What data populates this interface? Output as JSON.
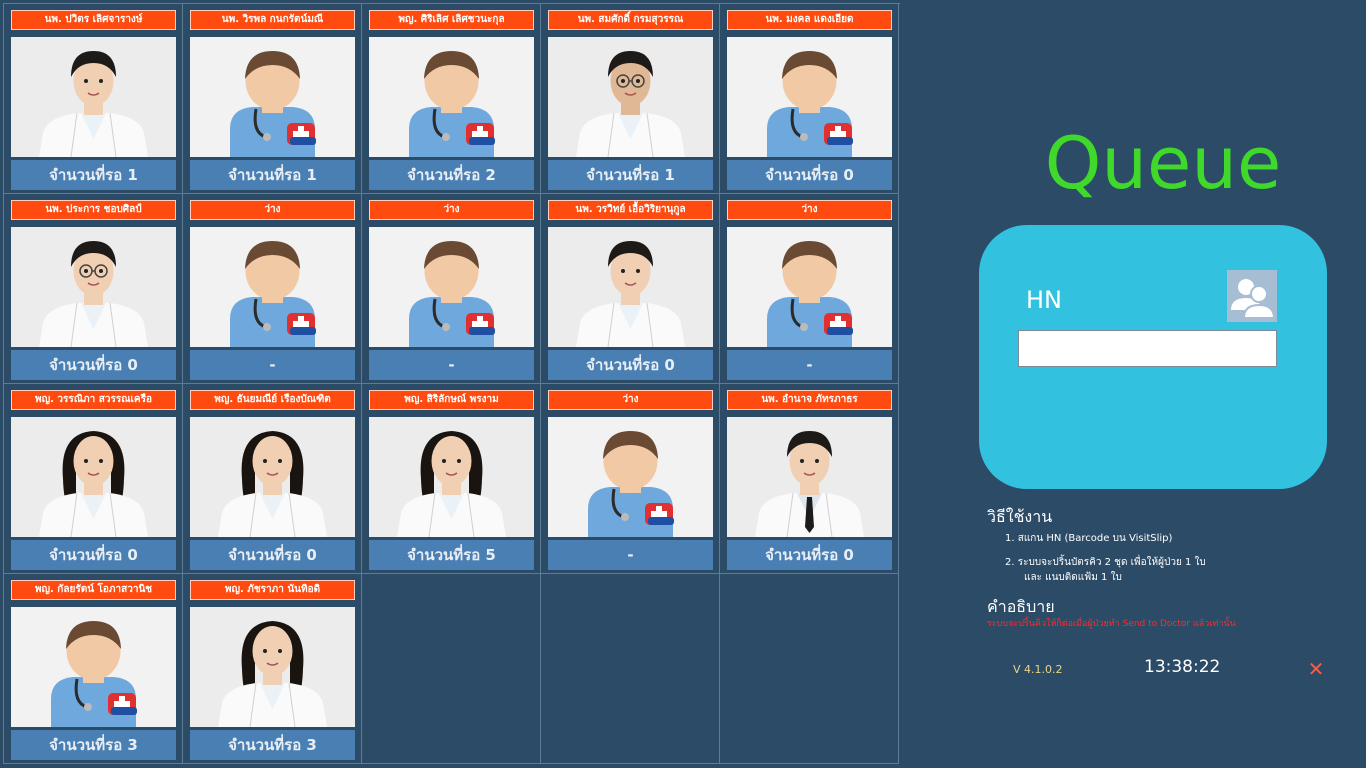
{
  "doctors": [
    {
      "name": "นพ. ปวิตร เลิศจารางษ์",
      "count": "จำนวนที่รอ  1",
      "photo": "photo-man-young"
    },
    {
      "name": "นพ. วิรพล กนกรัตน์มณี",
      "count": "จำนวนที่รอ  1",
      "photo": "placeholder"
    },
    {
      "name": "พญ. ศิริเลิศ เลิศชวนะกุล",
      "count": "จำนวนที่รอ  2",
      "photo": "placeholder"
    },
    {
      "name": "นพ. สมศักดิ์ กรมสุวรรณ",
      "count": "จำนวนที่รอ  1",
      "photo": "photo-man-glasses"
    },
    {
      "name": "นพ. มงคล แดงเอียด",
      "count": "จำนวนที่รอ  0",
      "photo": "placeholder"
    },
    {
      "name": "นพ. ประการ ชอบศิลป์",
      "count": "จำนวนที่รอ  0",
      "photo": "photo-man-glasses-2"
    },
    {
      "name": "ว่าง",
      "count": "-",
      "photo": "placeholder"
    },
    {
      "name": "ว่าง",
      "count": "-",
      "photo": "placeholder"
    },
    {
      "name": "นพ. วรวิทย์ เอื้อวิริยานุกูล",
      "count": "จำนวนที่รอ  0",
      "photo": "photo-man-young-2"
    },
    {
      "name": "ว่าง",
      "count": "-",
      "photo": "placeholder"
    },
    {
      "name": "พญ. วรรณิภา สวรรณเครือ",
      "count": "จำนวนที่รอ  0",
      "photo": "photo-woman-1"
    },
    {
      "name": "พญ. ธันยมณีย์ เรืองบัณฑิต",
      "count": "จำนวนที่รอ  0",
      "photo": "photo-woman-2"
    },
    {
      "name": "พญ. สิริลักษณ์ พรงาม",
      "count": "จำนวนที่รอ  5",
      "photo": "photo-woman-3"
    },
    {
      "name": "ว่าง",
      "count": "-",
      "photo": "placeholder"
    },
    {
      "name": "นพ. อำนาจ ภัทรภาธร",
      "count": "จำนวนที่รอ  0",
      "photo": "photo-man-young-3"
    },
    {
      "name": "พญ. กัลยรัตน์ โอภาสวานิช",
      "count": "จำนวนที่รอ  3",
      "photo": "placeholder"
    },
    {
      "name": "พญ. ภัชราภา นันทิอดิ",
      "count": "จำนวนที่รอ  3",
      "photo": "photo-woman-4"
    }
  ],
  "panel": {
    "title": "Queue",
    "hn_label": "HN",
    "hn_value": "",
    "howto_title": "วิธีใช้งาน",
    "howto_1": "1. สแกน HN (Barcode บน VisitSlip)",
    "howto_2": "2. ระบบจะปริ้นบัตรคิว 2 ชุด เพื่อให้ผู้ป่วย 1 ใบ",
    "howto_3": "และ แนบติดแฟ้ม 1 ใบ",
    "desc_title": "คำอธิบาย",
    "desc_text": "ระบบจะปริ้นคิวให้ก็ต่อเมื่อผู้ป่วยทำ Send to Doctor แล้วเท่านั้น",
    "version": "V 4.1.0.2",
    "clock": "13:38:22",
    "close_icon": "close-icon"
  },
  "colors": {
    "background": "#2c4b66",
    "name_bar": "#ff4a10",
    "count_bar": "#4a7fb3",
    "title": "#3fd82b",
    "hn_box": "#33c1e0",
    "desc_text": "#ff2a2a"
  }
}
